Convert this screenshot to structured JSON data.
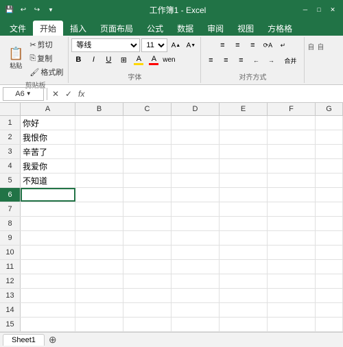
{
  "titleBar": {
    "title": "工作簿1 - Excel",
    "saveIcon": "💾",
    "undoIcon": "↩",
    "redoIcon": "↪",
    "quickAccessLabel": "自定义快速访问工具栏"
  },
  "ribbonTabs": {
    "tabs": [
      "文件",
      "开始",
      "插入",
      "页面布局",
      "公式",
      "数据",
      "审阅",
      "视图",
      "方格格"
    ]
  },
  "clipboard": {
    "label": "剪贴板",
    "pasteLabel": "粘贴",
    "cutLabel": "剪切",
    "copyLabel": "复制",
    "formatPainterLabel": "格式刷"
  },
  "font": {
    "label": "字体",
    "fontName": "等线",
    "fontSize": "11",
    "boldLabel": "B",
    "italicLabel": "I",
    "underlineLabel": "U",
    "borderLabel": "⊞",
    "fillLabel": "A",
    "fontColorLabel": "A",
    "increaseFontLabel": "A",
    "decreaseFontLabel": "A"
  },
  "alignment": {
    "label": "对齐方式"
  },
  "formulaBar": {
    "cellRef": "A6",
    "cancelIcon": "✕",
    "confirmIcon": "✓",
    "fxLabel": "fx",
    "formula": ""
  },
  "columns": [
    "A",
    "B",
    "C",
    "D",
    "E",
    "F",
    "G"
  ],
  "rows": [
    {
      "num": 1,
      "cells": [
        "你好",
        "",
        "",
        "",
        "",
        "",
        ""
      ]
    },
    {
      "num": 2,
      "cells": [
        "我恨你",
        "",
        "",
        "",
        "",
        "",
        ""
      ]
    },
    {
      "num": 3,
      "cells": [
        "辛苦了",
        "",
        "",
        "",
        "",
        "",
        ""
      ]
    },
    {
      "num": 4,
      "cells": [
        "我爱你",
        "",
        "",
        "",
        "",
        "",
        ""
      ]
    },
    {
      "num": 5,
      "cells": [
        "不知道",
        "",
        "",
        "",
        "",
        "",
        ""
      ]
    },
    {
      "num": 6,
      "cells": [
        "",
        "",
        "",
        "",
        "",
        "",
        ""
      ]
    },
    {
      "num": 7,
      "cells": [
        "",
        "",
        "",
        "",
        "",
        "",
        ""
      ]
    },
    {
      "num": 8,
      "cells": [
        "",
        "",
        "",
        "",
        "",
        "",
        ""
      ]
    },
    {
      "num": 9,
      "cells": [
        "",
        "",
        "",
        "",
        "",
        "",
        ""
      ]
    },
    {
      "num": 10,
      "cells": [
        "",
        "",
        "",
        "",
        "",
        "",
        ""
      ]
    },
    {
      "num": 11,
      "cells": [
        "",
        "",
        "",
        "",
        "",
        "",
        ""
      ]
    },
    {
      "num": 12,
      "cells": [
        "",
        "",
        "",
        "",
        "",
        "",
        ""
      ]
    },
    {
      "num": 13,
      "cells": [
        "",
        "",
        "",
        "",
        "",
        "",
        ""
      ]
    },
    {
      "num": 14,
      "cells": [
        "",
        "",
        "",
        "",
        "",
        "",
        ""
      ]
    },
    {
      "num": 15,
      "cells": [
        "",
        "",
        "",
        "",
        "",
        "",
        ""
      ]
    }
  ],
  "sheetTab": {
    "name": "Sheet1"
  }
}
